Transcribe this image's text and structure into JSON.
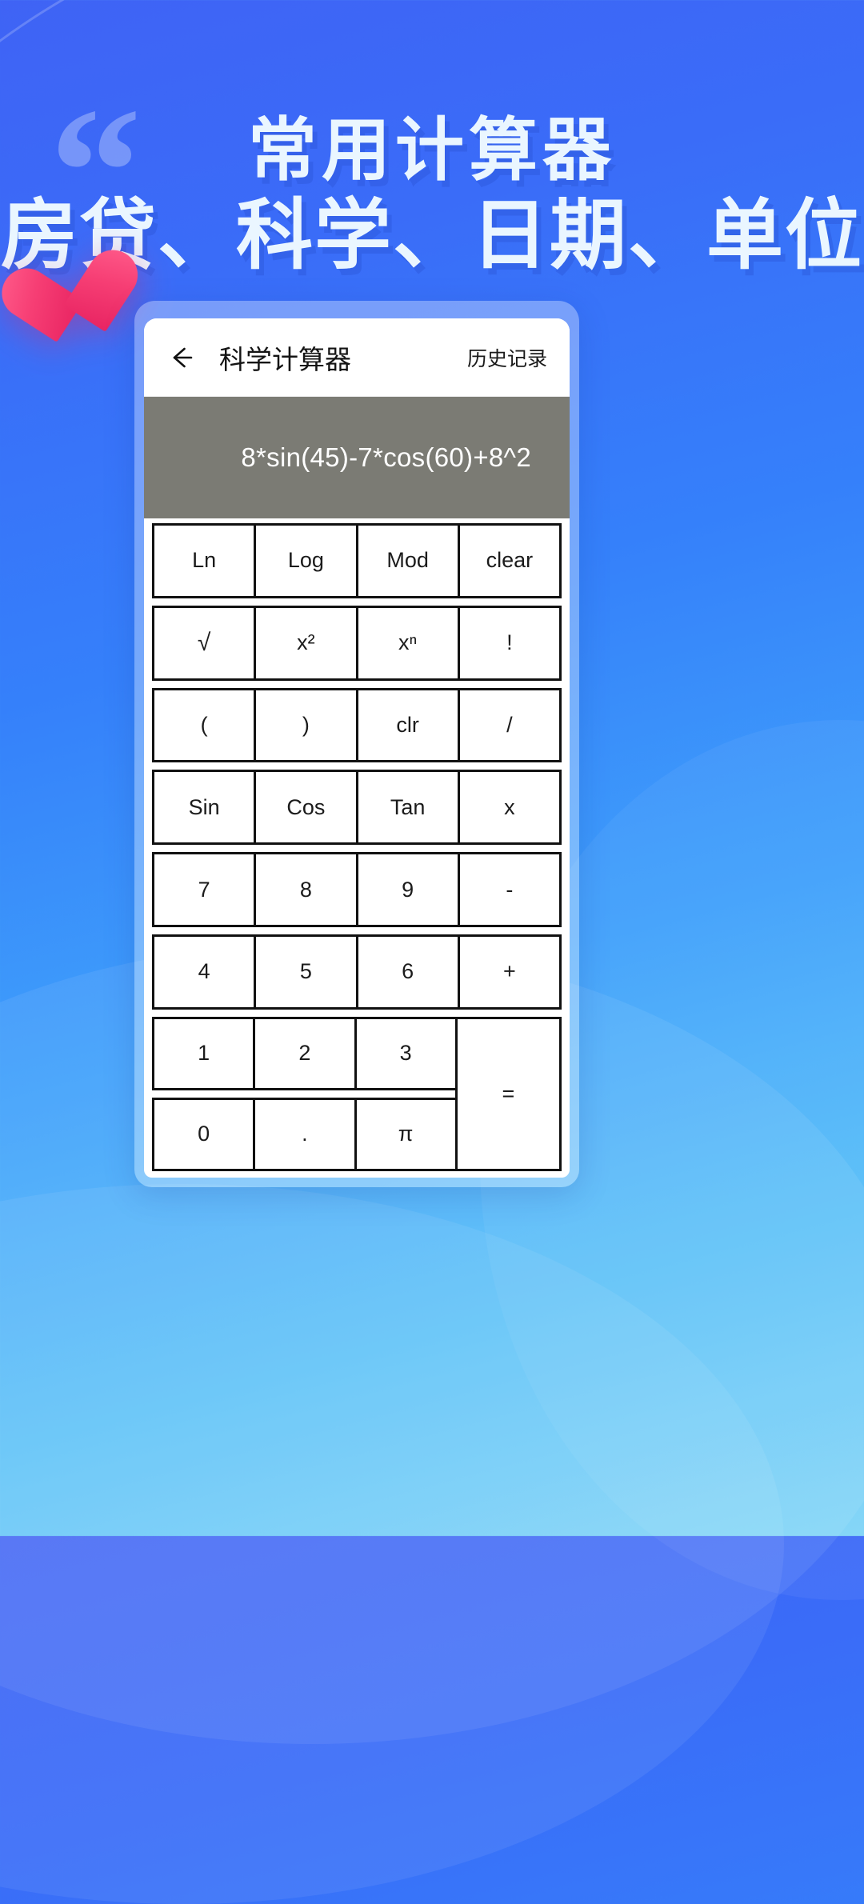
{
  "promo": {
    "quote_glyph": "“",
    "headline_line1": "常用计算器",
    "headline_line2": "房贷、科学、日期、单位"
  },
  "app": {
    "back_icon": "back-arrow-icon",
    "title": "科学计算器",
    "history_label": "历史记录",
    "display": {
      "expression": "8*sin(45)-7*cos(60)+8^2",
      "background": "#7b7b74",
      "text_color": "#ffffff"
    },
    "keypad": {
      "rows": [
        [
          "Ln",
          "Log",
          "Mod",
          "clear"
        ],
        [
          "√",
          "x²",
          "xⁿ",
          "!"
        ],
        [
          "(",
          ")",
          "clr",
          "/"
        ],
        [
          "Sin",
          "Cos",
          "Tan",
          "x"
        ],
        [
          "7",
          "8",
          "9",
          "-"
        ],
        [
          "4",
          "5",
          "6",
          "+"
        ]
      ],
      "bottom_rows": [
        [
          "1",
          "2",
          "3"
        ],
        [
          "0",
          ".",
          "π"
        ]
      ],
      "equals_label": "="
    }
  },
  "colors": {
    "bg_top": "#3f63f5",
    "bg_bottom": "#7fd4f7",
    "heart": "#f63e74",
    "headline_text": "#eaf6ff",
    "button_border": "#111111"
  }
}
